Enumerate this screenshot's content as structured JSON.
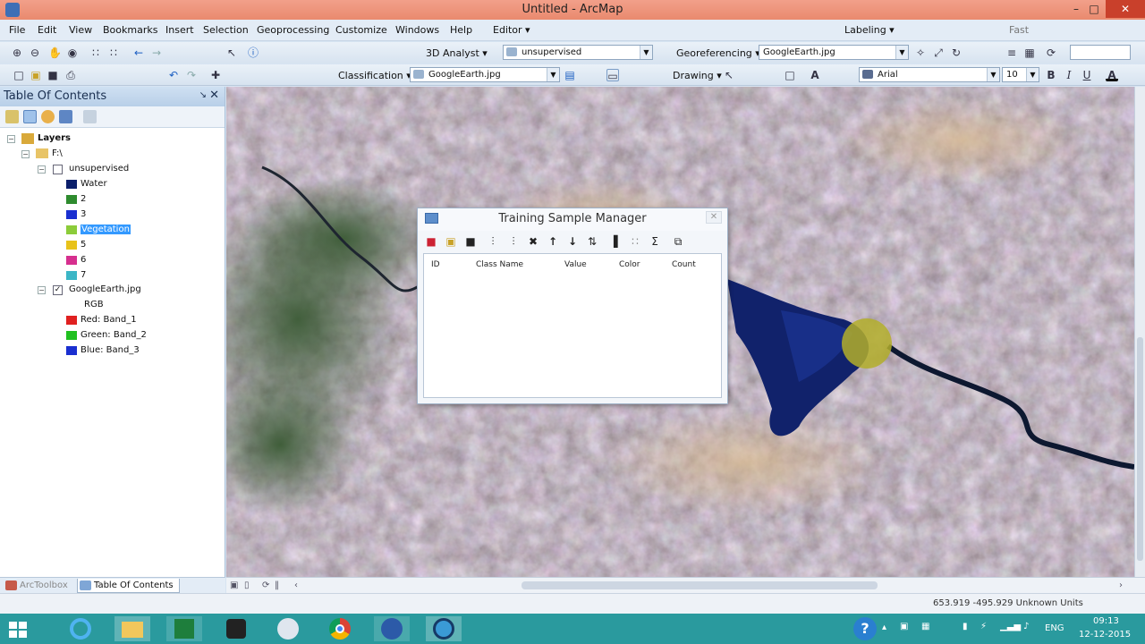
{
  "window": {
    "title": "Untitled - ArcMap",
    "min": "–",
    "max": "□",
    "close": "✕"
  },
  "menu": [
    "File",
    "Edit",
    "View",
    "Bookmarks",
    "Insert",
    "Selection",
    "Geoprocessing",
    "Customize",
    "Windows",
    "Help",
    "Editor ▾",
    "Labeling ▾",
    "Fast"
  ],
  "toolbar1": {
    "analyst_label": "3D Analyst ▾",
    "layer_combo": "unsupervised",
    "georef_label": "Georeferencing ▾",
    "georef_combo": "GoogleEarth.jpg"
  },
  "toolbar2": {
    "classification_label": "Classification ▾",
    "class_combo": "GoogleEarth.jpg",
    "drawing_label": "Drawing ▾",
    "font_combo": "Arial",
    "size_combo": "10",
    "bold": "B",
    "italic": "I",
    "underline": "U",
    "fontcolor": "A"
  },
  "toc": {
    "title": "Table Of Contents",
    "pin": "↘",
    "close": "✕",
    "layers_label": "Layers",
    "group_label": "F:\\",
    "unsupervised": {
      "label": "unsupervised",
      "classes": [
        {
          "label": "Water",
          "color": "#0b1f6b"
        },
        {
          "label": "2",
          "color": "#2e8b2e"
        },
        {
          "label": "3",
          "color": "#1a2fd0"
        },
        {
          "label": "Vegetation",
          "color": "#8ccc3a",
          "selected": true
        },
        {
          "label": "5",
          "color": "#e8c21a"
        },
        {
          "label": "6",
          "color": "#d62f8e"
        },
        {
          "label": "7",
          "color": "#3bb6c6"
        }
      ]
    },
    "googleearth": {
      "label": "GoogleEarth.jpg",
      "rgb": "RGB",
      "bands": [
        {
          "label": "Red:   Band_1",
          "color": "#e02020"
        },
        {
          "label": "Green: Band_2",
          "color": "#20c020"
        },
        {
          "label": "Blue:   Band_3",
          "color": "#1a2fd0"
        }
      ]
    }
  },
  "bottom_tabs": {
    "arctoolbox": "ArcToolbox",
    "toc": "Table Of Contents"
  },
  "status": {
    "coords": "653.919  -495.929 Unknown Units"
  },
  "dialog": {
    "title": "Training Sample Manager",
    "close": "✕",
    "columns": [
      "ID",
      "Class Name",
      "Value",
      "Color",
      "Count"
    ]
  },
  "taskbar": {
    "language": "ENG",
    "time": "09:13",
    "date": "12-12-2015",
    "help_icon": "?"
  }
}
